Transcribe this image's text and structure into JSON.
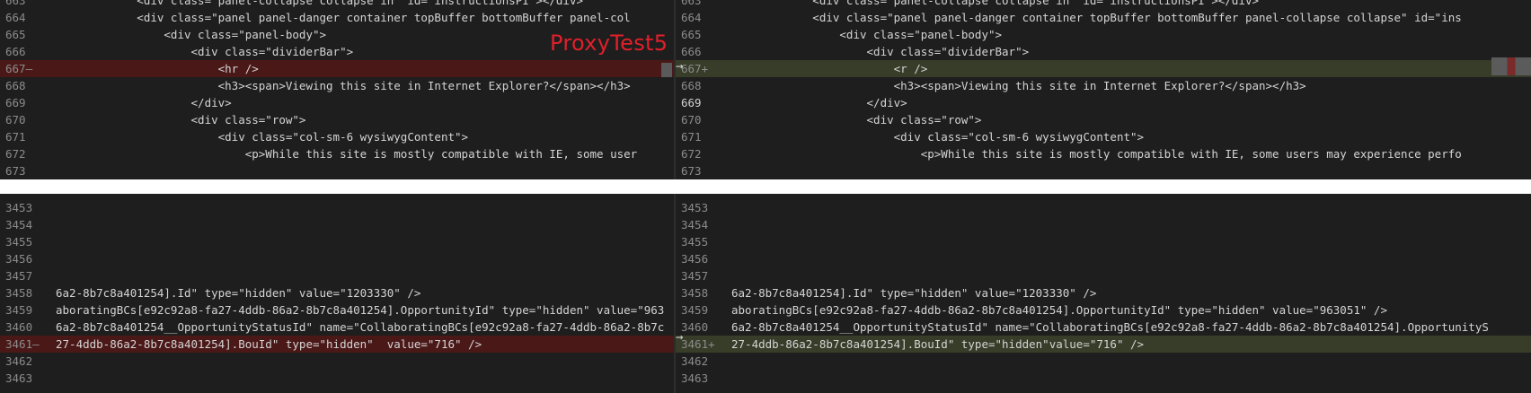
{
  "overlay": {
    "label": "ProxyTest5"
  },
  "top_diff": {
    "left_lines": [
      {
        "num": "663",
        "code": "            <div class=\"panel-collapse collapse in\" id=\"instructionsPI\"></div>",
        "state": "normal"
      },
      {
        "num": "664",
        "code": "            <div class=\"panel panel-danger container topBuffer bottomBuffer panel-col",
        "state": "normal"
      },
      {
        "num": "665",
        "code": "                <div class=\"panel-body\">",
        "state": "normal"
      },
      {
        "num": "666",
        "code": "                    <div class=\"dividerBar\">",
        "state": "normal"
      },
      {
        "num": "667–",
        "code": "                        <hr />",
        "state": "removed"
      },
      {
        "num": "668",
        "code": "                        <h3><span>Viewing this site in Internet Explorer?</span></h3>",
        "state": "normal"
      },
      {
        "num": "669",
        "code": "                    </div>",
        "state": "normal"
      },
      {
        "num": "670",
        "code": "                    <div class=\"row\">",
        "state": "normal"
      },
      {
        "num": "671",
        "code": "                        <div class=\"col-sm-6 wysiwygContent\">",
        "state": "normal"
      },
      {
        "num": "672",
        "code": "                            <p>While this site is mostly compatible with IE, some user",
        "state": "normal"
      },
      {
        "num": "673",
        "code": "",
        "state": "normal"
      }
    ],
    "right_lines": [
      {
        "num": "663",
        "code": "            <div class=\"panel-collapse collapse in\" id=\"instructionsPI\"></div>",
        "state": "normal"
      },
      {
        "num": "664",
        "code": "            <div class=\"panel panel-danger container topBuffer bottomBuffer panel-collapse collapse\" id=\"ins",
        "state": "normal"
      },
      {
        "num": "665",
        "code": "                <div class=\"panel-body\">",
        "state": "normal"
      },
      {
        "num": "666",
        "code": "                    <div class=\"dividerBar\">",
        "state": "normal"
      },
      {
        "num": "667+",
        "code": "                        <r />",
        "state": "added"
      },
      {
        "num": "668",
        "code": "                        <h3><span>Viewing this site in Internet Explorer?</span></h3>",
        "state": "normal"
      },
      {
        "num": "669",
        "code": "                    </div>",
        "state": "active"
      },
      {
        "num": "670",
        "code": "                    <div class=\"row\">",
        "state": "normal"
      },
      {
        "num": "671",
        "code": "                        <div class=\"col-sm-6 wysiwygContent\">",
        "state": "normal"
      },
      {
        "num": "672",
        "code": "                            <p>While this site is mostly compatible with IE, some users may experience perfo",
        "state": "normal"
      },
      {
        "num": "673",
        "code": "",
        "state": "normal"
      }
    ]
  },
  "bottom_diff": {
    "left_lines": [
      {
        "num": "3453",
        "code": "",
        "state": "normal"
      },
      {
        "num": "3454",
        "code": "",
        "state": "normal"
      },
      {
        "num": "3455",
        "code": "",
        "state": "normal"
      },
      {
        "num": "3456",
        "code": "",
        "state": "normal"
      },
      {
        "num": "3457",
        "code": "",
        "state": "normal"
      },
      {
        "num": "3458",
        "code": "6a2-8b7c8a401254].Id\" type=\"hidden\" value=\"1203330\" />",
        "state": "normal"
      },
      {
        "num": "3459",
        "code": "aboratingBCs[e92c92a8-fa27-4ddb-86a2-8b7c8a401254].OpportunityId\" type=\"hidden\" value=\"963",
        "state": "normal"
      },
      {
        "num": "3460",
        "code": "6a2-8b7c8a401254__OpportunityStatusId\" name=\"CollaboratingBCs[e92c92a8-fa27-4ddb-86a2-8b7c",
        "state": "normal"
      },
      {
        "num": "3461–",
        "code": "27-4ddb-86a2-8b7c8a401254].BouId\" type=\"hidden\"  value=\"716\" />",
        "state": "removed"
      },
      {
        "num": "3462",
        "code": "",
        "state": "normal"
      },
      {
        "num": "3463",
        "code": "",
        "state": "normal"
      }
    ],
    "right_lines": [
      {
        "num": "3453",
        "code": "",
        "state": "normal"
      },
      {
        "num": "3454",
        "code": "",
        "state": "normal"
      },
      {
        "num": "3455",
        "code": "",
        "state": "normal"
      },
      {
        "num": "3456",
        "code": "",
        "state": "normal"
      },
      {
        "num": "3457",
        "code": "",
        "state": "normal"
      },
      {
        "num": "3458",
        "code": "6a2-8b7c8a401254].Id\" type=\"hidden\" value=\"1203330\" />",
        "state": "normal"
      },
      {
        "num": "3459",
        "code": "aboratingBCs[e92c92a8-fa27-4ddb-86a2-8b7c8a401254].OpportunityId\" type=\"hidden\" value=\"963051\" />",
        "state": "normal"
      },
      {
        "num": "3460",
        "code": "6a2-8b7c8a401254__OpportunityStatusId\" name=\"CollaboratingBCs[e92c92a8-fa27-4ddb-86a2-8b7c8a401254].OpportunityS",
        "state": "normal"
      },
      {
        "num": "3461+",
        "code": "27-4ddb-86a2-8b7c8a401254].BouId\" type=\"hidden\"value=\"716\" />",
        "state": "added"
      },
      {
        "num": "3462",
        "code": "",
        "state": "normal"
      },
      {
        "num": "3463",
        "code": "",
        "state": "normal"
      }
    ]
  },
  "icons": {
    "change_arrow": "→"
  },
  "colors": {
    "editor_bg": "#1e1e1e",
    "removed_line": "#4b1818",
    "added_line": "#373d29",
    "overlay_text": "#e0202a"
  }
}
